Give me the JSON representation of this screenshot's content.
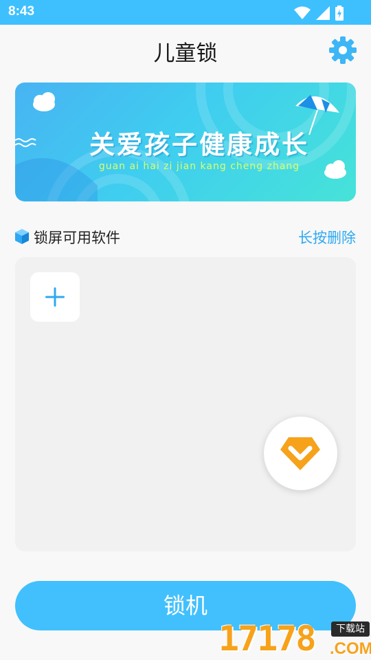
{
  "status_bar": {
    "time": "8:43",
    "icons": [
      "wifi-icon",
      "signal-icon",
      "battery-charging-icon"
    ]
  },
  "header": {
    "title": "儿童锁",
    "settings_icon": "gear-icon"
  },
  "banner": {
    "title": "关爱孩子健康成长",
    "pinyin": "guan ai hai zi jian kang cheng zhang"
  },
  "section": {
    "icon": "cube-icon",
    "title": "锁屏可用软件",
    "action": "长按删除"
  },
  "app_panel": {
    "add_icon": "plus-icon"
  },
  "vip_button": {
    "icon": "vip-diamond-icon"
  },
  "lock_button": {
    "label": "锁机"
  },
  "watermark": {
    "digits": "17178",
    "tag": "下载站",
    "domain": ".COM"
  },
  "colors": {
    "accent": "#41c0fd",
    "status_bar": "#3ec0ff",
    "action_text": "#2fa9f0",
    "vip": "#f7a21b"
  }
}
